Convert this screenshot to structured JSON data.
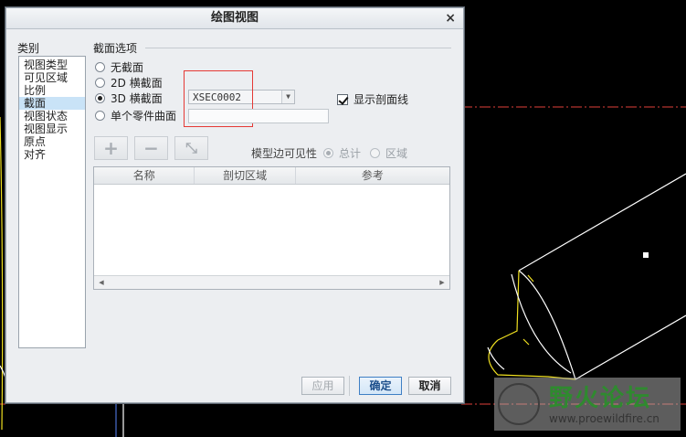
{
  "dialog": {
    "title": "绘图视图",
    "close_glyph": "×",
    "category_label": "类别",
    "categories": [
      "视图类型",
      "可见区域",
      "比例",
      "截面",
      "视图状态",
      "视图显示",
      "原点",
      "对齐"
    ],
    "selected_category": "截面",
    "section_options_label": "截面选项",
    "options": {
      "none": "无截面",
      "2d": "2D 横截面",
      "3d": "3D 横截面",
      "single_part": "单个零件曲面"
    },
    "selected_option": "3D 横截面",
    "xsec_value": "XSEC0002",
    "show_hatch_label": "显示剖面线",
    "show_hatch_checked": true,
    "toolbar": {
      "add": "+",
      "remove": "−",
      "flip": "⤡"
    },
    "model_edge_visibility_label": "模型边可见性",
    "visibility_options": {
      "total": "总计",
      "area": "区域"
    },
    "table_headers": [
      "名称",
      "剖切区域",
      "参考"
    ],
    "buttons": {
      "apply": "应用",
      "ok": "确定",
      "cancel": "取消"
    }
  },
  "watermark": {
    "title": "野火论坛",
    "url": "www.proewildfire.cn"
  },
  "colors": {
    "cad_background": "#000000",
    "centerline": "#e0403a",
    "edge_yellow": "#f0e020",
    "edge_white": "#ffffff",
    "highlight_box": "#e53935"
  }
}
